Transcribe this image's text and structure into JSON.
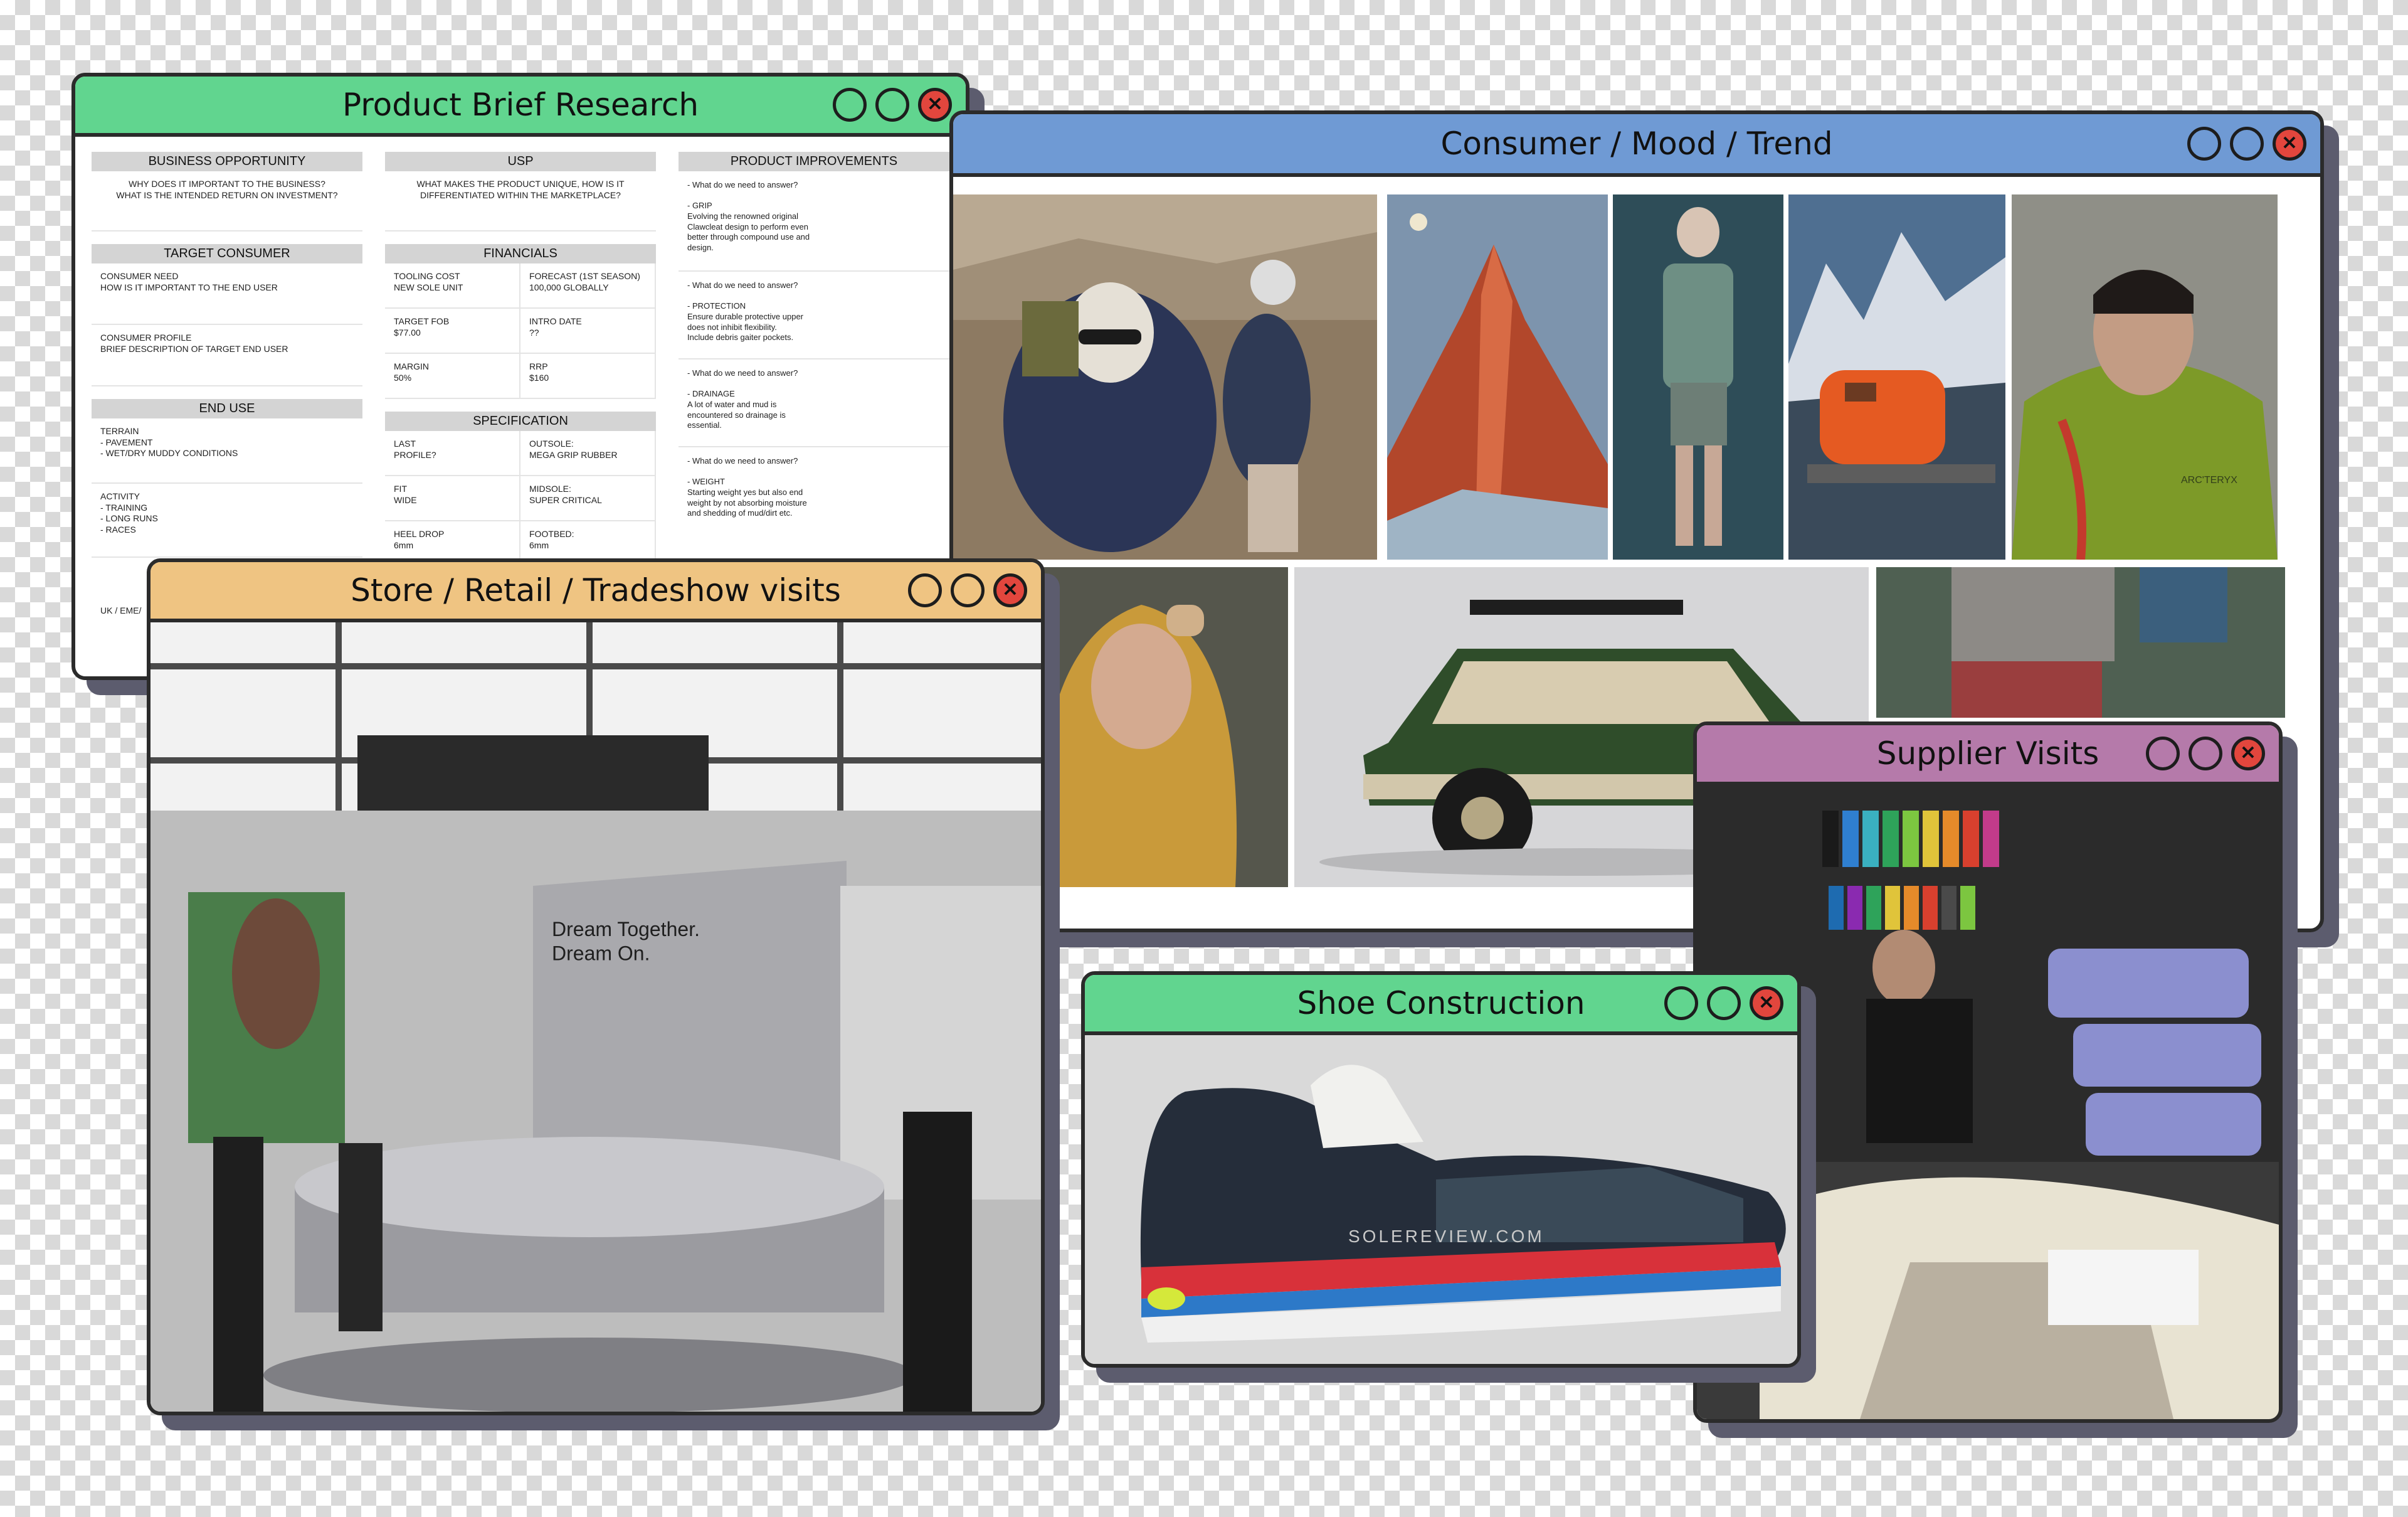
{
  "colors": {
    "brief_bar": "#61d58f",
    "mood_bar": "#6f9ad4",
    "store_bar": "#efc482",
    "supplier_bar": "#b57aaa",
    "shoe_bar": "#61d58f",
    "close_button": "#e2463d"
  },
  "windows": {
    "brief": {
      "title": "Product Brief Research",
      "col1": {
        "business_head": "BUSINESS OPPORTUNITY",
        "business_text": "WHY DOES IT IMPORTANT TO THE BUSINESS?\nWHAT IS THE INTENDED RETURN ON INVESTMENT?",
        "target_head": "TARGET CONSUMER",
        "need_text": "CONSUMER NEED\nHOW IS IT IMPORTANT TO THE END USER",
        "profile_text": "CONSUMER PROFILE\nBRIEF DESCRIPTION OF TARGET END USER",
        "enduse_head": "END USE",
        "terrain_text": "TERRAIN\n- PAVEMENT\n- WET/DRY MUDDY CONDITIONS",
        "activity_text": "ACTIVITY\n- TRAINING\n- LONG RUNS\n- RACES",
        "region_text": "UK / EME/"
      },
      "col2": {
        "usp_head": "USP",
        "usp_text": "WHAT MAKES THE PRODUCT UNIQUE, HOW IS IT\nDIFFERENTIATED WITHIN THE MARKETPLACE?",
        "fin_head": "FINANCIALS",
        "fin_cells": [
          "TOOLING COST\nNEW SOLE UNIT",
          "FORECAST (1ST SEASON)\n100,000 GLOBALLY",
          "TARGET FOB\n$77.00",
          "INTRO DATE\n??",
          "MARGIN\n50%",
          "RRP\n$160"
        ],
        "spec_head": "SPECIFICATION",
        "spec_cells": [
          "LAST\nPROFILE?",
          "OUTSOLE:\nMEGA GRIP RUBBER",
          "FIT\nWIDE",
          "MIDSOLE:\nSUPER CRITICAL",
          "HEEL DROP\n6mm",
          "FOOTBED:\n6mm"
        ]
      },
      "col3": {
        "improve_head": "PRODUCT IMPROVEMENTS",
        "items": [
          "- What do we need to answer?\n\n- GRIP\nEvolving the renowned original\nClawcleat design to perform even\nbetter through compound use and\ndesign.",
          "- What do we need to answer?\n\n- PROTECTION\nEnsure durable protective upper\ndoes not inhibit flexibility.\nInclude debris gaiter pockets.",
          "- What do we need to answer?\n\n- DRAINAGE\nA lot of water and mud is\nencountered so drainage is\nessential.",
          "- What do we need to answer?\n\n- WEIGHT\nStarting weight yes but also end\nweight by not absorbing moisture\nand shedding of mud/dirt etc."
        ]
      }
    },
    "mood": {
      "title": "Consumer / Mood / Trend",
      "images": [
        "mountaineers-photo",
        "red-peak-photo",
        "vest-model-photo",
        "orange-hut-photo",
        "green-jacket-portrait",
        "yellow-hood-photo",
        "green-suv-photo",
        "runner-photo"
      ],
      "logo_text": "ARC'TERYX"
    },
    "store": {
      "title": "Store / Retail / Tradeshow visits",
      "display_text": "Dream Together.\nDream On."
    },
    "supplier": {
      "title": "Supplier Visits"
    },
    "shoe": {
      "title": "Shoe Construction",
      "watermark": "SOLEREVIEW.COM"
    }
  }
}
